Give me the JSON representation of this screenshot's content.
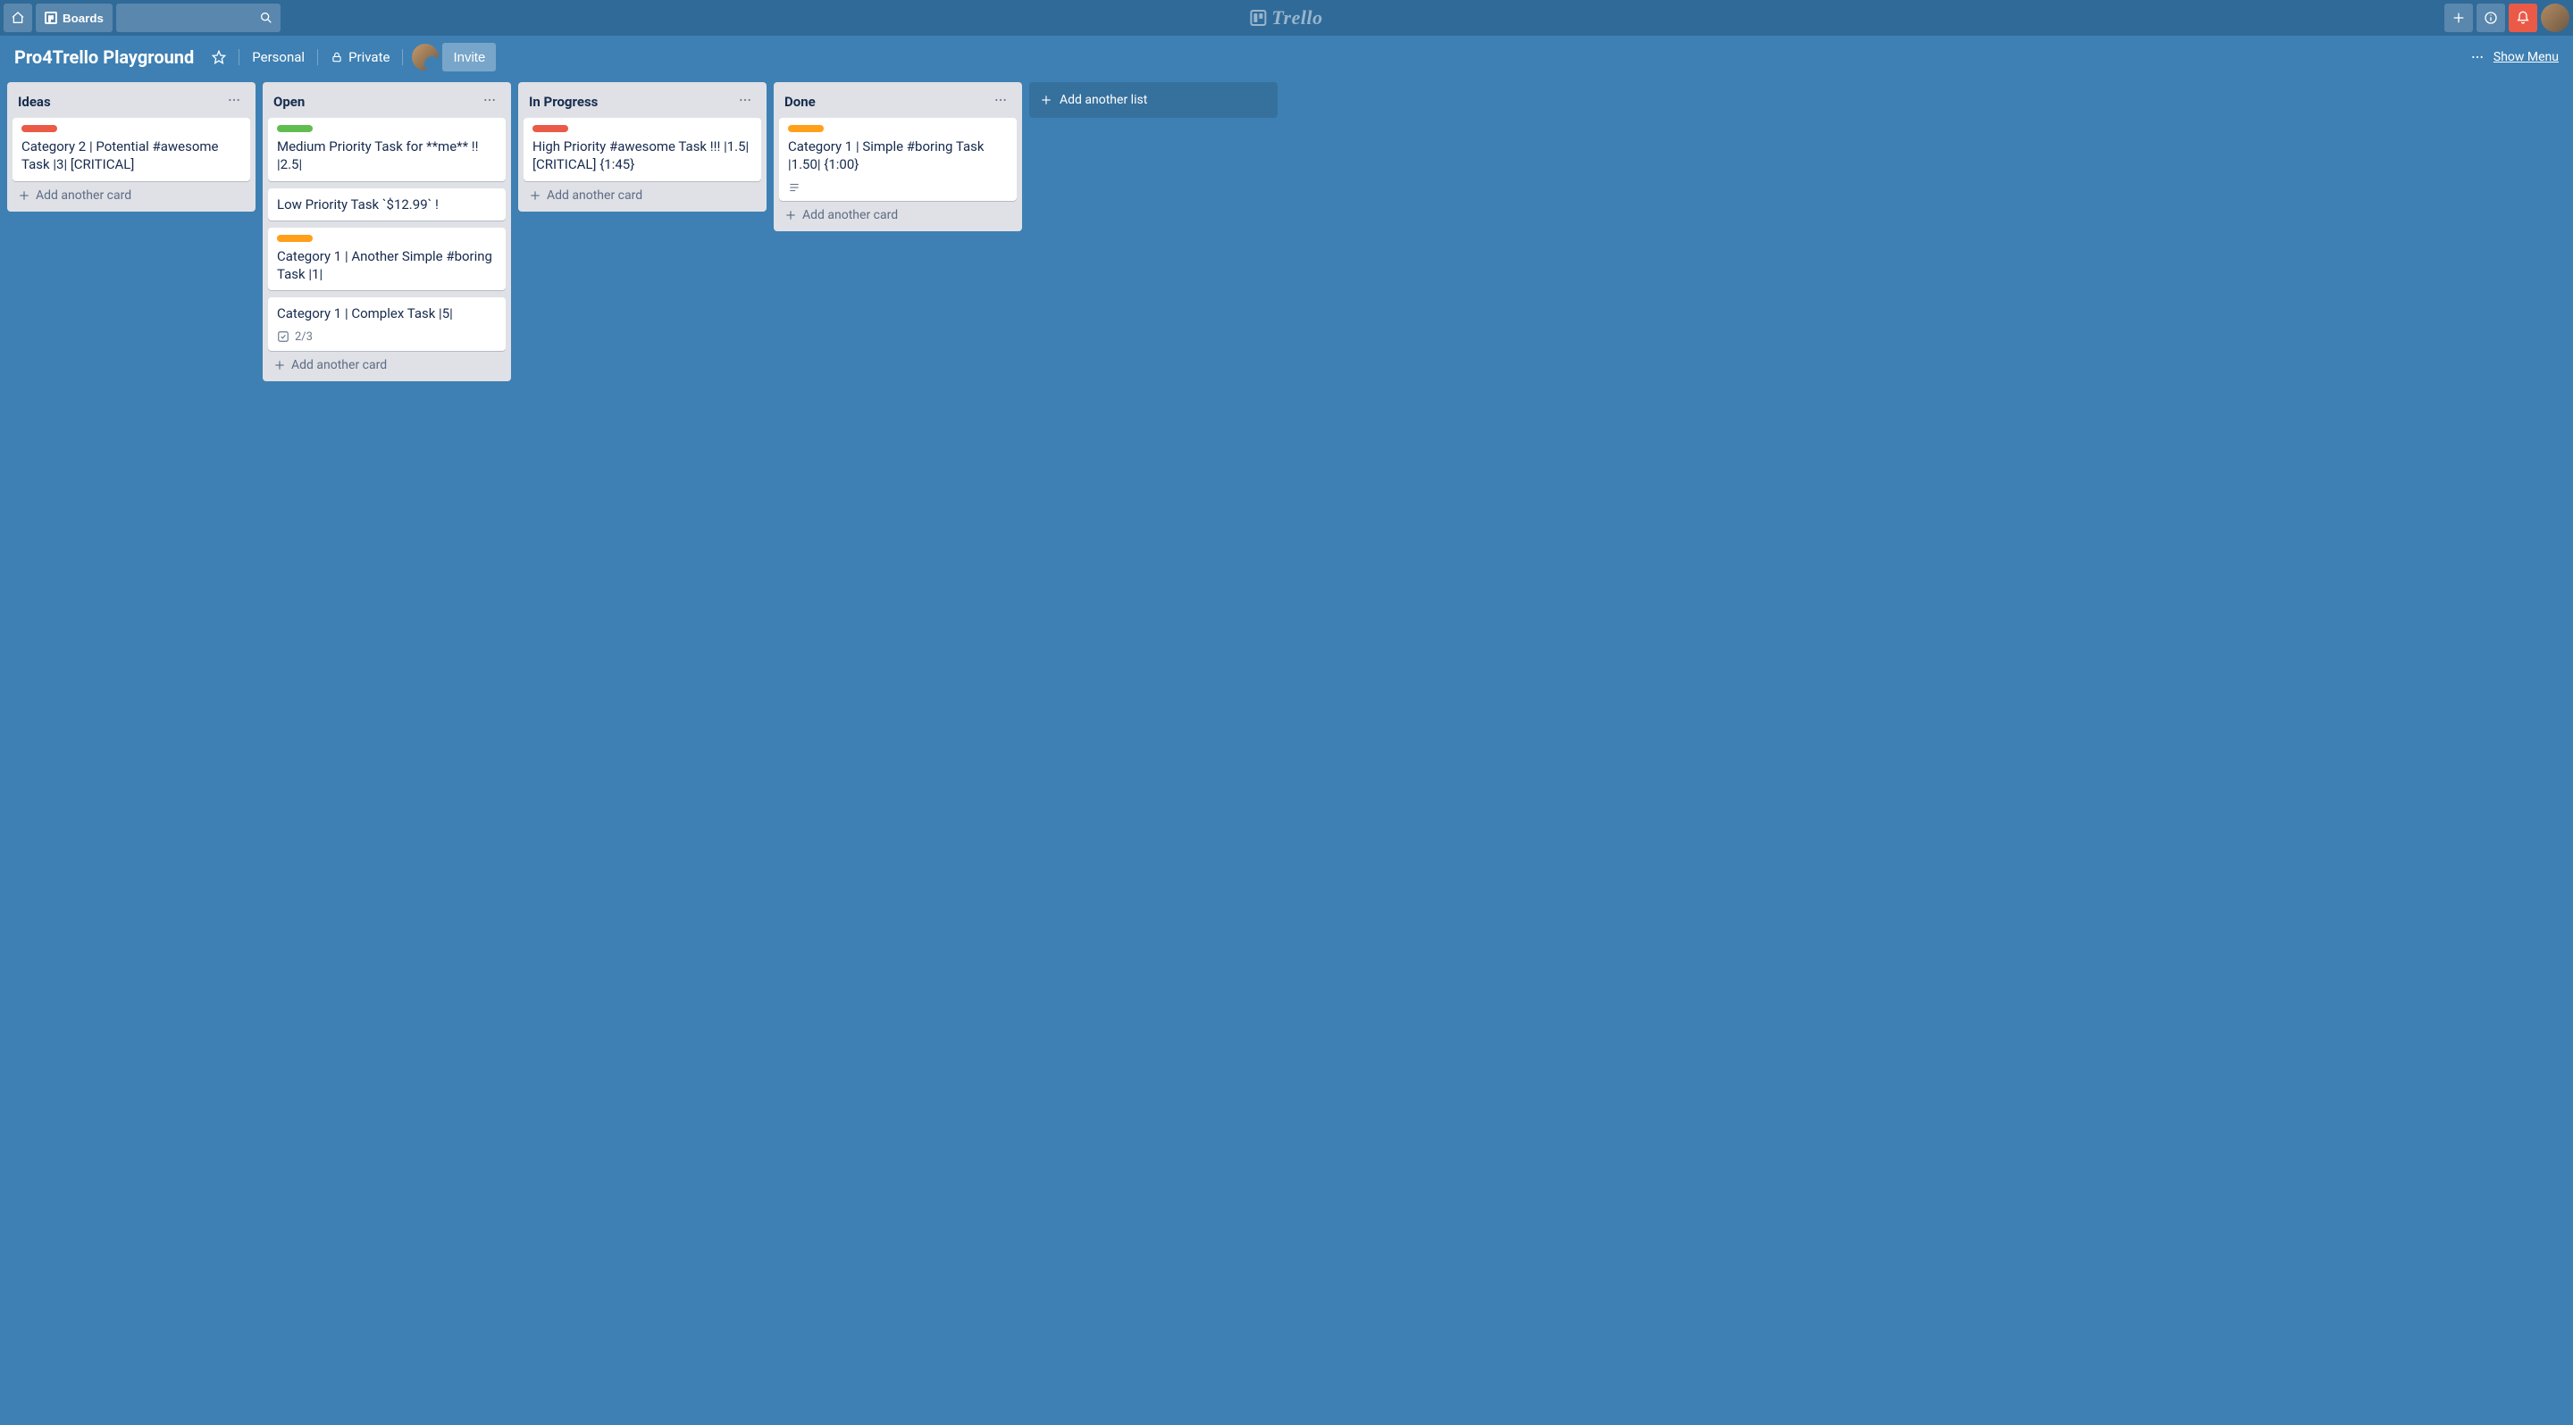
{
  "app": {
    "name": "Trello",
    "boards_label": "Boards"
  },
  "header_icons": {
    "home": "home-icon",
    "boards": "boards-icon",
    "search": "search-icon",
    "add": "plus-icon",
    "info": "info-icon",
    "notifications": "bell-icon",
    "avatar": "user-avatar"
  },
  "board": {
    "title": "Pro4Trello Playground",
    "star": "star-icon",
    "team_label": "Personal",
    "visibility_label": "Private",
    "visibility_icon": "lock-icon",
    "invite_label": "Invite",
    "show_menu_label": "Show Menu",
    "menu_icon": "ellipsis-icon"
  },
  "lists": [
    {
      "title": "Ideas",
      "cards": [
        {
          "label": "red",
          "title": "Category 2 | Potential #awesome Task |3| [CRITICAL]"
        }
      ]
    },
    {
      "title": "Open",
      "cards": [
        {
          "label": "green",
          "title": "Medium Priority Task for **me** !! |2.5|"
        },
        {
          "label": null,
          "title": "Low Priority Task `$12.99` !"
        },
        {
          "label": "orange",
          "title": "Category 1 | Another Simple #boring Task |1|"
        },
        {
          "label": null,
          "title": "Category 1 | Complex Task |5|",
          "checklist": "2/3"
        }
      ]
    },
    {
      "title": "In Progress",
      "cards": [
        {
          "label": "red",
          "title": "High Priority #awesome Task !!! |1.5| [CRITICAL] {1:45}"
        }
      ]
    },
    {
      "title": "Done",
      "cards": [
        {
          "label": "orange",
          "title": "Category 1 | Simple #boring Task |1.50| {1:00}",
          "has_description": true
        }
      ]
    }
  ],
  "strings": {
    "add_card": "Add another card",
    "add_list": "Add another list"
  },
  "colors": {
    "board_bg": "#3e80b3",
    "header_bg": "#306a99",
    "list_bg": "#dfe1e6",
    "notif_bg": "#eb5a46"
  }
}
